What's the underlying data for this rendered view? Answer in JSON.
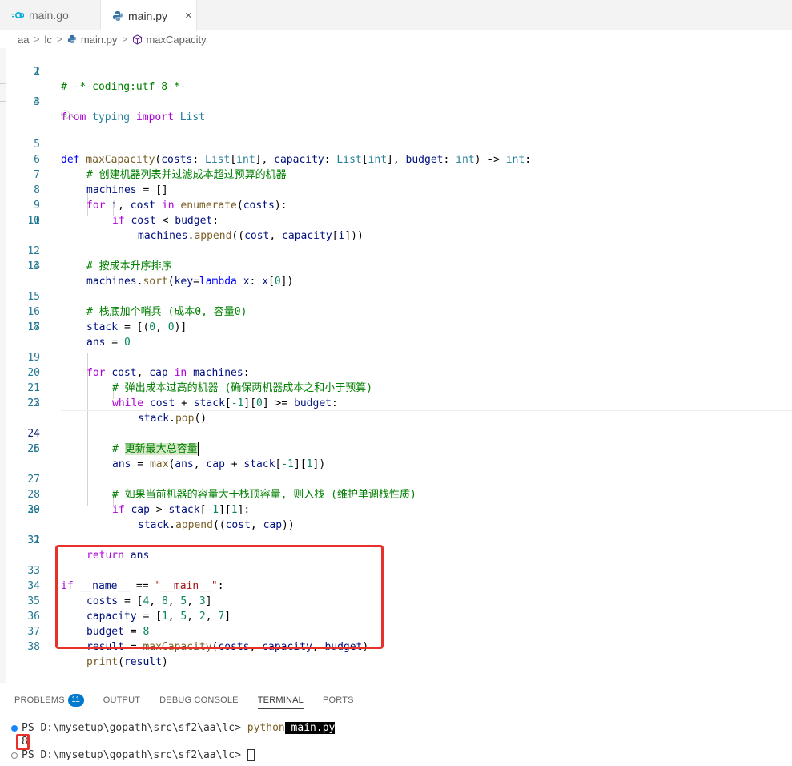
{
  "tabs": [
    {
      "label": "main.go",
      "icon": "go-file-icon"
    },
    {
      "label": "main.py",
      "icon": "python-file-icon",
      "active": true,
      "close": "×"
    }
  ],
  "breadcrumb": [
    "aa",
    "lc",
    "main.py",
    "maxCapacity"
  ],
  "codelens": "ⓓ⌄",
  "line_numbers": [
    "1",
    "2",
    "3",
    "4",
    "5",
    "6",
    "7",
    "8",
    "9",
    "10",
    "11",
    "12",
    "13",
    "14",
    "15",
    "16",
    "17",
    "18",
    "19",
    "20",
    "21",
    "22",
    "23",
    "24",
    "25",
    "26",
    "27",
    "28",
    "29",
    "30",
    "31",
    "32",
    "33",
    "34",
    "35",
    "36",
    "37",
    "38"
  ],
  "code": {
    "l1": "# -*-coding:utf-8-*-",
    "l3": [
      "from",
      "typing",
      "import",
      "List"
    ],
    "l5": [
      "def",
      "maxCapacity",
      "costs",
      "List",
      "int",
      "capacity",
      "List",
      "int",
      "budget",
      "int",
      "int"
    ],
    "l6": "# 创建机器列表并过滤成本超过预算的机器",
    "l7": [
      "machines",
      "= []"
    ],
    "l8": [
      "for",
      "i",
      "cost",
      "in",
      "enumerate",
      "costs"
    ],
    "l9": [
      "if",
      "cost",
      "budget"
    ],
    "l10": [
      "machines",
      "append",
      "cost",
      "capacity",
      "i"
    ],
    "l12": "# 按成本升序排序",
    "l13": [
      "machines",
      "sort",
      "key",
      "lambda",
      "x",
      "x",
      "0"
    ],
    "l15": "# 栈底加个哨兵 (成本0, 容量0)",
    "l16": [
      "stack",
      "0",
      "0"
    ],
    "l17": [
      "ans",
      "0"
    ],
    "l19": [
      "for",
      "cost",
      "cap",
      "in",
      "machines"
    ],
    "l20": "# 弹出成本过高的机器 (确保两机器成本之和小于预算)",
    "l21": [
      "while",
      "cost",
      "stack",
      "-1",
      "0",
      "budget"
    ],
    "l22": [
      "stack",
      "pop"
    ],
    "l24a": "# ",
    "l24b": "更新最大总容量",
    "l25": [
      "ans",
      "max",
      "ans",
      "cap",
      "stack",
      "-1",
      "1"
    ],
    "l27": "# 如果当前机器的容量大于栈顶容量, 则入栈 (维护单调栈性质)",
    "l28": [
      "if",
      "cap",
      "stack",
      "-1",
      "1"
    ],
    "l29": [
      "stack",
      "append",
      "cost",
      "cap"
    ],
    "l31": [
      "return",
      "ans"
    ],
    "l33": [
      "if",
      "__name__",
      "\"__main__\""
    ],
    "l34": [
      "costs",
      "4",
      "8",
      "5",
      "3"
    ],
    "l35": [
      "capacity",
      "1",
      "5",
      "2",
      "7"
    ],
    "l36": [
      "budget",
      "8"
    ],
    "l37": [
      "result",
      "maxCapacity",
      "costs",
      "capacity",
      "budget"
    ],
    "l38": [
      "print",
      "result"
    ]
  },
  "panel": {
    "tabs": [
      "PROBLEMS",
      "OUTPUT",
      "DEBUG CONSOLE",
      "TERMINAL",
      "PORTS"
    ],
    "problems_count": "11",
    "active_tab": "TERMINAL"
  },
  "terminal": {
    "prompt1": "PS D:\\mysetup\\gopath\\src\\sf2\\aa\\lc> ",
    "cmd": "python",
    "arg": " main.py",
    "output": "8",
    "prompt2": "PS D:\\mysetup\\gopath\\src\\sf2\\aa\\lc> "
  },
  "colors": {
    "keyword": "#0000ff",
    "control": "#af00db",
    "function": "#795e26",
    "type": "#267f99",
    "comment": "#008000",
    "string": "#a31515",
    "highlight_border": "#e8302a",
    "badge": "#007acc"
  }
}
